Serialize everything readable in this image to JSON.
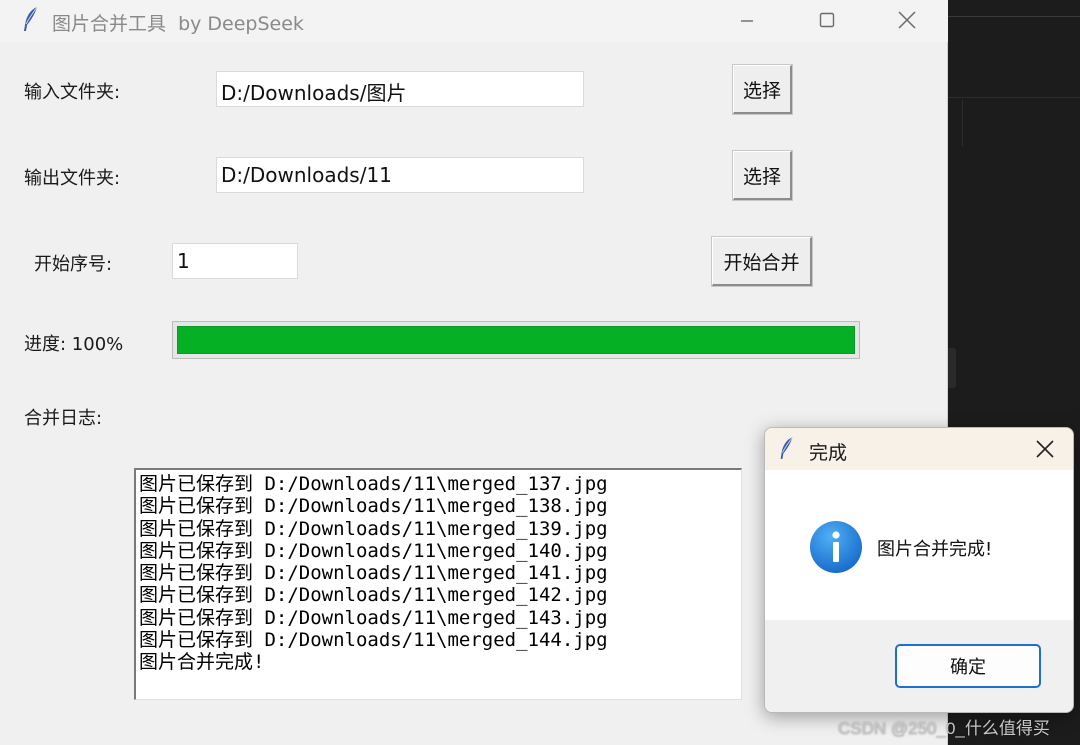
{
  "colors": {
    "progress_fill": "#06b025",
    "desktop_background": "#1c1c1c",
    "window_background": "#f0f0f0",
    "dialog_accent": "#1f6fd1",
    "info_icon": "#1a7fd6"
  },
  "main_window": {
    "title": "图片合并工具  by DeepSeek",
    "icon": "feather-icon",
    "controls": {
      "minimize_icon": "minimize-icon",
      "maximize_icon": "maximize-icon",
      "close_icon": "close-icon"
    }
  },
  "form": {
    "input_folder": {
      "label": "输入文件夹:",
      "value": "D:/Downloads/图片",
      "button": "选择"
    },
    "output_folder": {
      "label": "输出文件夹:",
      "value": "D:/Downloads/11",
      "button": "选择"
    },
    "start_index": {
      "label": "开始序号:",
      "value": "1"
    },
    "start_button": "开始合并",
    "progress": {
      "label": "进度: 100%",
      "value": 1.0
    },
    "log": {
      "label": "合并日志:",
      "lines": [
        "图片已保存到 D:/Downloads/11\\merged_137.jpg",
        "图片已保存到 D:/Downloads/11\\merged_138.jpg",
        "图片已保存到 D:/Downloads/11\\merged_139.jpg",
        "图片已保存到 D:/Downloads/11\\merged_140.jpg",
        "图片已保存到 D:/Downloads/11\\merged_141.jpg",
        "图片已保存到 D:/Downloads/11\\merged_142.jpg",
        "图片已保存到 D:/Downloads/11\\merged_143.jpg",
        "图片已保存到 D:/Downloads/11\\merged_144.jpg",
        "图片合并完成!"
      ]
    }
  },
  "dialog": {
    "title": "完成",
    "icon": "info-icon",
    "message": "图片合并完成!",
    "ok_button": "确定"
  },
  "watermark": "CSDN @250_0_什么值得买"
}
